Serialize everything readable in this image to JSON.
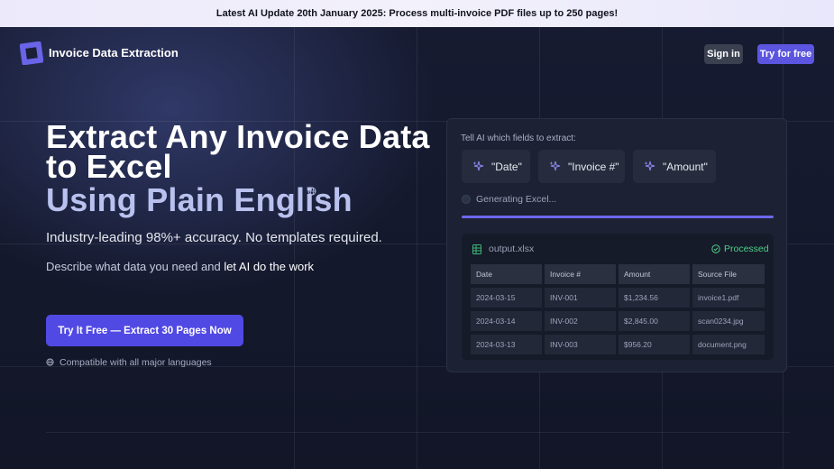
{
  "banner": {
    "text": "Latest AI Update 20th January 2025: Process multi-invoice PDF files up to 250 pages!"
  },
  "nav": {
    "brand": "Invoice Data Extraction",
    "sign_in": "Sign in",
    "try_free": "Try for free"
  },
  "hero": {
    "title_line1": "Extract Any Invoice Data",
    "title_line2": "to Excel",
    "title_line3": "Using Plain English",
    "subtitle": "Industry-leading 98%+ accuracy. No templates required.",
    "describe_prefix": "Describe what data you need and ",
    "describe_highlight": "let AI do the work",
    "cta": "Try It Free — Extract 30 Pages Now",
    "compat": "Compatible with all major languages"
  },
  "demo": {
    "prompt_label": "Tell AI which fields to extract:",
    "chips": [
      "\"Date\"",
      "\"Invoice #\"",
      "\"Amount\""
    ],
    "generating_text": "Generating Excel...",
    "progress": 1.0,
    "file_name": "output.xlsx",
    "status": "Processed",
    "columns": [
      "Date",
      "Invoice #",
      "Amount",
      "Source File"
    ],
    "rows": [
      [
        "2024-03-15",
        "INV-001",
        "$1,234.56",
        "invoice1.pdf"
      ],
      [
        "2024-03-14",
        "INV-002",
        "$2,845.00",
        "scan0234.jpg"
      ],
      [
        "2024-03-13",
        "INV-003",
        "$956.20",
        "document.png"
      ]
    ]
  },
  "colors": {
    "accent": "#5b55e0",
    "cta": "#5149e4",
    "success": "#4fd08a",
    "background": "#121627"
  }
}
